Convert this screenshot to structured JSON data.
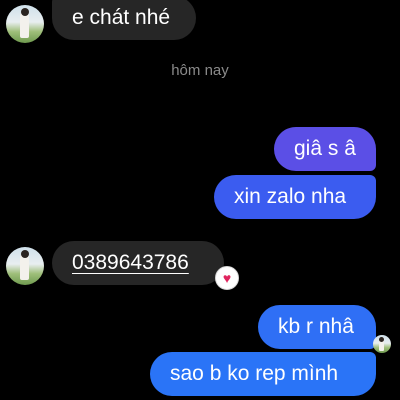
{
  "messages": {
    "m1": {
      "text": "e chát nhé"
    },
    "m2": {
      "text": "giâ s â"
    },
    "m3": {
      "text": "xin zalo nha"
    },
    "m4": {
      "text": "0389643786",
      "reaction": "♥"
    },
    "m5": {
      "text": "kb r nhâ"
    },
    "m6": {
      "text": "sao b ko rep mình"
    }
  },
  "date_separator": "hôm nay",
  "colors": {
    "incoming_bubble": "#262626",
    "outgoing_purple": "#5b4fe6",
    "outgoing_blue": "#2a74f7",
    "reaction_heart": "#e0245e"
  },
  "icons": {
    "avatar": "contact-avatar",
    "reaction": "heart-reaction-icon",
    "seen": "seen-avatar"
  }
}
